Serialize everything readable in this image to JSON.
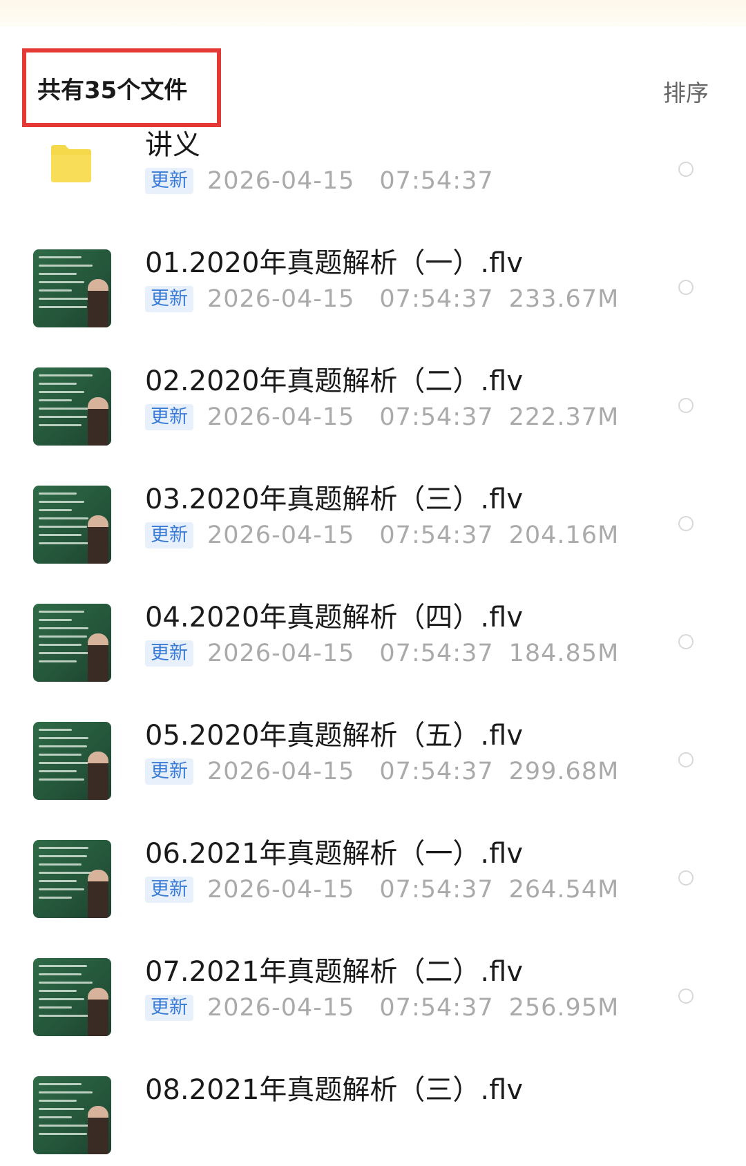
{
  "header": {
    "file_count": "共有35个文件",
    "sort_label": "排序"
  },
  "badge_label": "更新",
  "files": [
    {
      "name": "讲义",
      "date": "2026-04-15",
      "time": "07:54:37",
      "size": "",
      "icon": "folder-icon"
    },
    {
      "name": "01.2020年真题解析（一）.flv",
      "date": "2026-04-15",
      "time": "07:54:37",
      "size": "233.67M",
      "icon": "video-thumbnail"
    },
    {
      "name": "02.2020年真题解析（二）.flv",
      "date": "2026-04-15",
      "time": "07:54:37",
      "size": "222.37M",
      "icon": "video-thumbnail"
    },
    {
      "name": "03.2020年真题解析（三）.flv",
      "date": "2026-04-15",
      "time": "07:54:37",
      "size": "204.16M",
      "icon": "video-thumbnail"
    },
    {
      "name": "04.2020年真题解析（四）.flv",
      "date": "2026-04-15",
      "time": "07:54:37",
      "size": "184.85M",
      "icon": "video-thumbnail"
    },
    {
      "name": "05.2020年真题解析（五）.flv",
      "date": "2026-04-15",
      "time": "07:54:37",
      "size": "299.68M",
      "icon": "video-thumbnail"
    },
    {
      "name": "06.2021年真题解析（一）.flv",
      "date": "2026-04-15",
      "time": "07:54:37",
      "size": "264.54M",
      "icon": "video-thumbnail"
    },
    {
      "name": "07.2021年真题解析（二）.flv",
      "date": "2026-04-15",
      "time": "07:54:37",
      "size": "256.95M",
      "icon": "video-thumbnail"
    },
    {
      "name": "08.2021年真题解析（三）.flv",
      "date": "",
      "time": "",
      "size": "",
      "icon": "video-thumbnail"
    }
  ],
  "colors": {
    "highlight_border": "#e53935",
    "badge_text": "#3a7bd5",
    "badge_bg": "#e8f1fb",
    "folder": "#f6d94a",
    "thumbnail_board": "#2f6b47"
  }
}
